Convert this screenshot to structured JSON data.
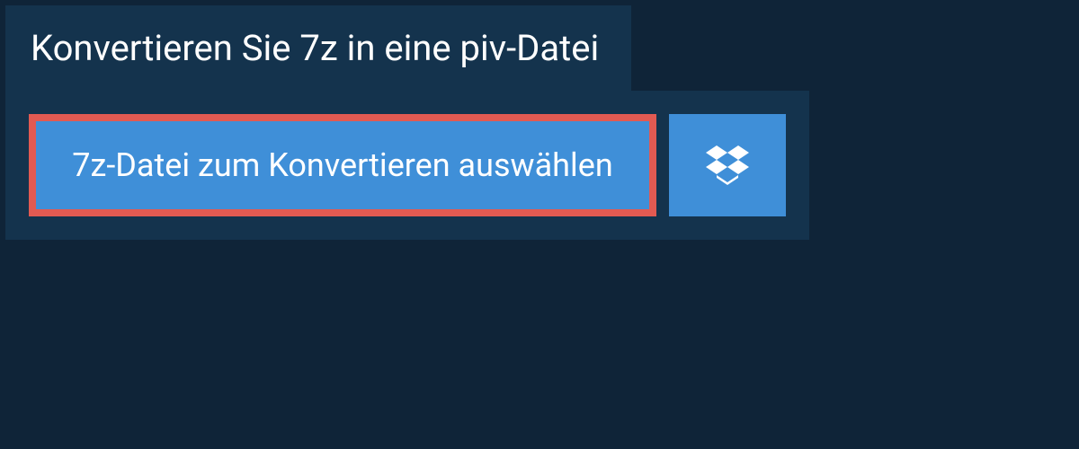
{
  "header": {
    "title": "Konvertieren Sie 7z in eine piv-Datei"
  },
  "actions": {
    "select_file_label": "7z-Datei zum Konvertieren auswählen"
  },
  "colors": {
    "page_bg": "#0f2438",
    "panel_bg": "#14334d",
    "button_bg": "#3f8fd8",
    "highlight_border": "#e25a52",
    "text": "#ffffff"
  }
}
